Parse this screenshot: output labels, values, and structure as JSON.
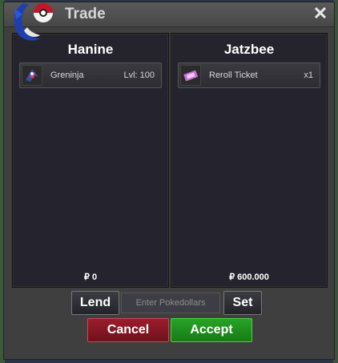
{
  "window": {
    "title": "Trade",
    "close_icon": "close-icon"
  },
  "left_panel": {
    "player_name": "Hanine",
    "items": [
      {
        "icon": "greninja-sprite-icon",
        "name": "Greninja",
        "detail": "Lvl: 100"
      }
    ],
    "money": "₽ 0"
  },
  "right_panel": {
    "player_name": "Jatzbee",
    "items": [
      {
        "icon": "reroll-ticket-icon",
        "name": "Reroll Ticket",
        "detail": "x1"
      }
    ],
    "money": "₽ 600.000"
  },
  "controls": {
    "lend_label": "Lend",
    "pokedollars_placeholder": "Enter Pokedollars",
    "set_label": "Set",
    "cancel_label": "Cancel",
    "accept_label": "Accept"
  },
  "colors": {
    "cancel": "#9b1d2b",
    "accept": "#27a326",
    "panel_bg": "#25242e",
    "window_bg": "#3f3f3f"
  }
}
